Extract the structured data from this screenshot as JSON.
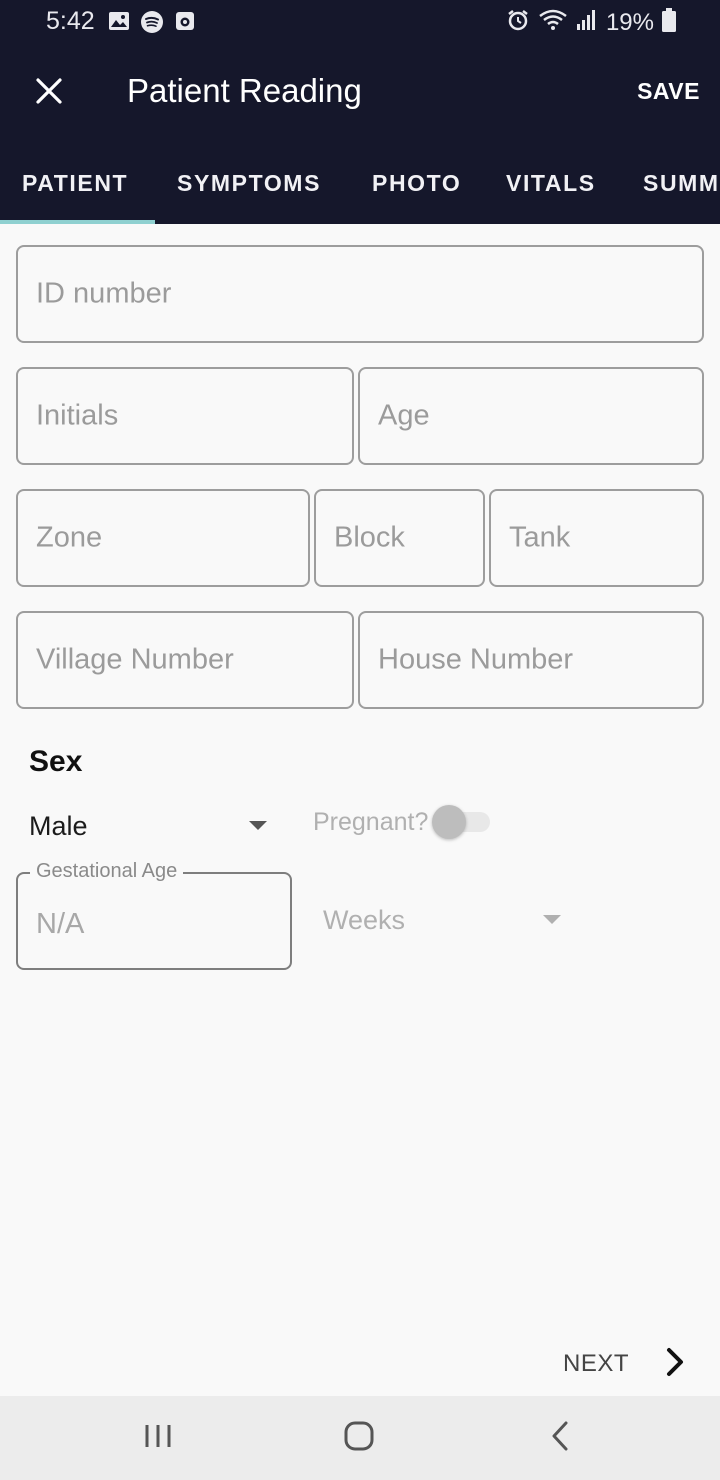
{
  "status_bar": {
    "time": "5:42",
    "battery_text": "19%",
    "left_icons": [
      "gallery-icon",
      "spotify-icon",
      "camera-app-icon"
    ],
    "right_icons": [
      "alarm-icon",
      "wifi-icon",
      "signal-icon",
      "battery-icon"
    ]
  },
  "app_bar": {
    "title": "Patient Reading",
    "save_label": "SAVE",
    "background": "#15172b"
  },
  "tabs": [
    {
      "label": "PATIENT",
      "active": true
    },
    {
      "label": "SYMPTOMS",
      "active": false
    },
    {
      "label": "PHOTO",
      "active": false
    },
    {
      "label": "VITALS",
      "active": false
    },
    {
      "label": "SUMM",
      "active": false
    }
  ],
  "tab_indicator_color": "#8fd0d0",
  "form": {
    "id_number": {
      "placeholder": "ID number",
      "value": ""
    },
    "initials": {
      "placeholder": "Initials",
      "value": ""
    },
    "age": {
      "placeholder": "Age",
      "value": ""
    },
    "zone": {
      "placeholder": "Zone",
      "value": ""
    },
    "block": {
      "placeholder": "Block",
      "value": ""
    },
    "tank": {
      "placeholder": "Tank",
      "value": ""
    },
    "village_number": {
      "placeholder": "Village Number",
      "value": ""
    },
    "house_number": {
      "placeholder": "House Number",
      "value": ""
    },
    "sex": {
      "label": "Sex",
      "selected": "Male"
    },
    "pregnant": {
      "label": "Pregnant?",
      "on": false,
      "enabled": false
    },
    "gestational_age": {
      "label": "Gestational Age",
      "value": "N/A"
    },
    "gestational_unit": {
      "selected": "Weeks",
      "enabled": false
    }
  },
  "next_label": "NEXT"
}
